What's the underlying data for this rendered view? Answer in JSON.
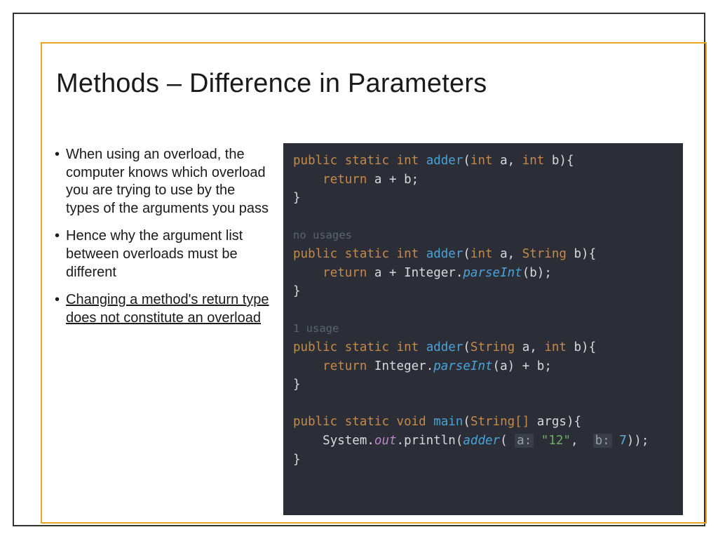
{
  "title": "Methods – Difference in Parameters",
  "bullets": {
    "b1": "When using an overload, the computer knows which overload you are trying to use by the types of the arguments you pass",
    "b2": "Hence why the argument list between overloads must be different",
    "b3": "Changing a method's return type does not constitute an overload"
  },
  "code": {
    "kw_public": "public",
    "kw_static": "static",
    "kw_return": "return",
    "kw_void": "void",
    "t_int": "int",
    "t_String": "String",
    "t_StringArr": "String[]",
    "fn_adder": "adder",
    "fn_main": "main",
    "fn_println": "println",
    "fn_parseInt": "parseInt",
    "id_a": "a",
    "id_b": "b",
    "id_args": "args",
    "cls_Integer": "Integer",
    "cls_System": "System",
    "fld_out": "out",
    "usage_none": "no usages",
    "usage_one": "1 usage",
    "str_12": "\"12\"",
    "num_7": "7",
    "hint_a": "a:",
    "hint_b": "b:",
    "plus": " + ",
    "comma": ", ",
    "op_brace_open": "{",
    "op_brace_close": "}",
    "op_paren_open": "(",
    "op_paren_close": ")",
    "semi": ";",
    "dot": "."
  }
}
